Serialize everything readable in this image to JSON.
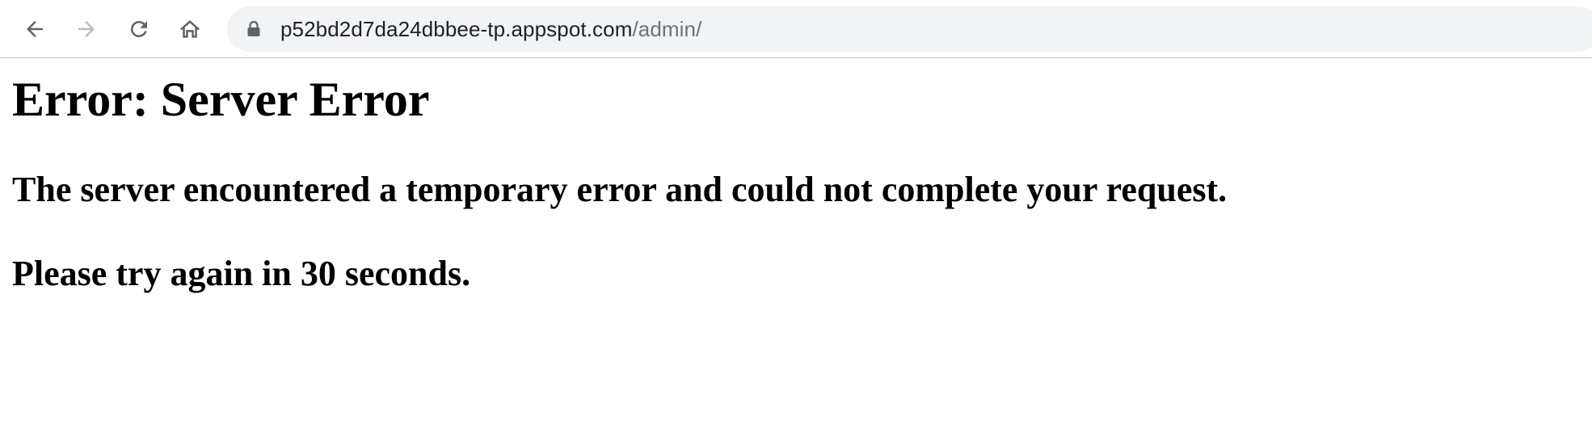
{
  "browser": {
    "url_host": "p52bd2d7da24dbbee-tp.appspot.com",
    "url_path": "/admin/",
    "icons": {
      "back": "arrow-left-icon",
      "forward": "arrow-right-icon",
      "reload": "reload-icon",
      "home": "home-icon",
      "lock": "lock-icon"
    },
    "colors": {
      "omnibox_bg": "#f1f3f4",
      "icon_active": "#5f6368",
      "icon_disabled": "#babcbe"
    }
  },
  "page": {
    "title": "Error: Server Error",
    "message": "The server encountered a temporary error and could not complete your request.",
    "retry": "Please try again in 30 seconds."
  }
}
